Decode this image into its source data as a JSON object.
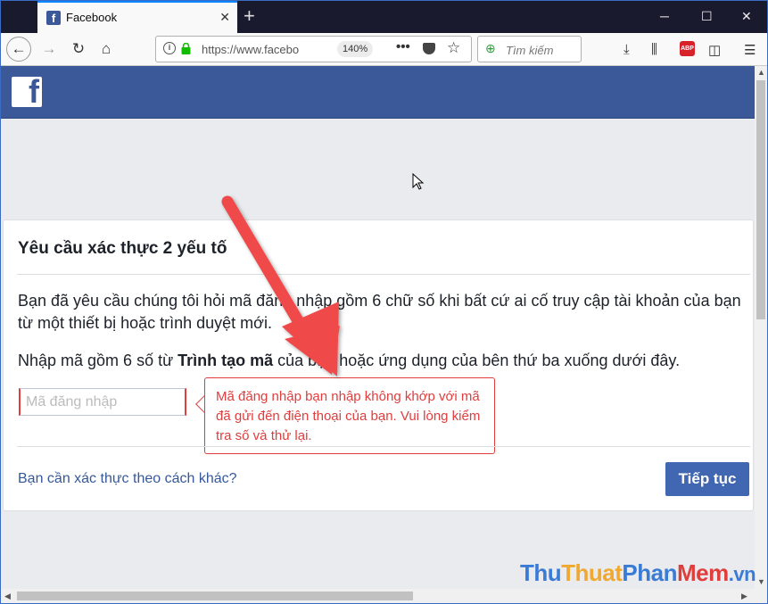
{
  "browser": {
    "tab_title": "Facebook",
    "favicon_letter": "f",
    "url": "https://www.facebo",
    "zoom": "140%",
    "search_placeholder": "Tìm kiếm",
    "abp_label": "ABP"
  },
  "page": {
    "logo_letter": "f",
    "heading": "Yêu cầu xác thực 2 yếu tố",
    "paragraph1": "Bạn đã yêu cầu chúng tôi hỏi mã đăng nhập gồm 6 chữ số khi bất cứ ai cố truy cập tài khoản của bạn từ một thiết bị hoặc trình duyệt mới.",
    "paragraph2_prefix": "Nhập mã gồm 6 số từ ",
    "paragraph2_bold": "Trình tạo mã",
    "paragraph2_suffix": " của bạn hoặc ứng dụng của bên thứ ba xuống dưới đây.",
    "code_placeholder": "Mã đăng nhập",
    "error_message": "Mã đăng nhập bạn nhập không khớp với mã đã gửi đến điện thoại của bạn. Vui lòng kiểm tra số và thử lại.",
    "alt_link": "Bạn cần xác thực theo cách khác?",
    "continue_label": "Tiếp tục"
  },
  "watermark": {
    "part1": "Thu",
    "part2": "Thuat",
    "part3": "Phan",
    "part4": "Mem",
    "part5": ".vn"
  },
  "colors": {
    "fb_blue": "#3b5998",
    "button_blue": "#4267b2",
    "error_red": "#e03d3d",
    "arrow_red": "#f04a4a"
  }
}
